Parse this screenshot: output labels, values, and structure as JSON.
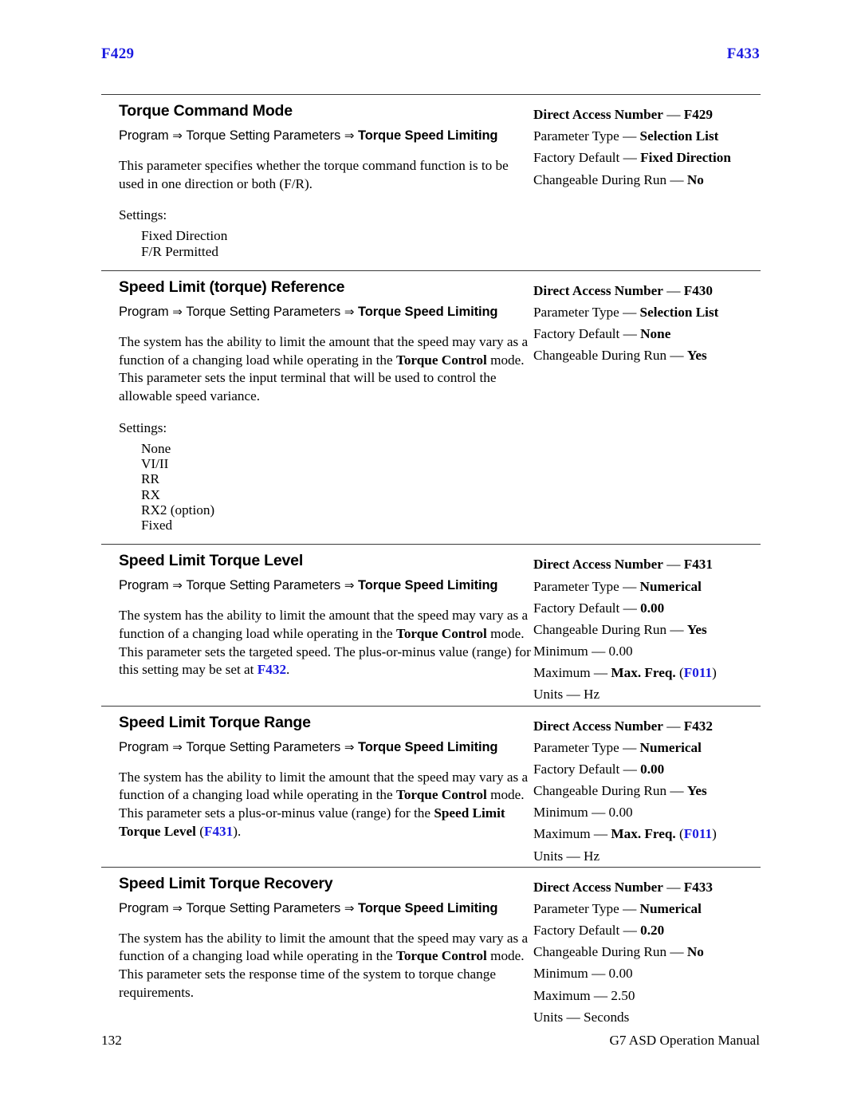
{
  "running_head": {
    "left": "F429",
    "right": "F433",
    "color": "#1a1ae0"
  },
  "footer": {
    "page_number": "132",
    "manual_title": "G7 ASD Operation Manual"
  },
  "common": {
    "breadcrumb_prefix": "Program",
    "breadcrumb_mid": "Torque Setting Parameters",
    "breadcrumb_end": "Torque Speed Limiting",
    "arrow": "⇒",
    "settings_label": "Settings:",
    "dash": "—",
    "key_direct_access": "Direct Access Number",
    "key_parameter_type": "Parameter Type",
    "key_factory_default": "Factory Default",
    "key_changeable": "Changeable During Run",
    "key_minimum": "Minimum",
    "key_maximum": "Maximum",
    "key_units": "Units"
  },
  "sections": [
    {
      "title": "Torque Command Mode",
      "description_parts": [
        {
          "text": "This parameter specifies whether the torque command function is to be used in one direction or both (F/R).",
          "style": "normal"
        }
      ],
      "settings": [
        "Fixed Direction",
        "F/R Permitted"
      ],
      "specs": {
        "direct_access_number": "F429",
        "parameter_type": "Selection List",
        "factory_default": "Fixed Direction",
        "changeable_during_run": "No"
      }
    },
    {
      "title": "Speed Limit (torque) Reference",
      "description_parts": [
        {
          "text": "The system has the ability to limit the amount that the speed may vary as a function of a changing load while operating in the ",
          "style": "normal"
        },
        {
          "text": "Torque Control",
          "style": "bold"
        },
        {
          "text": " mode. This parameter sets the input terminal that will be used to control the allowable speed variance.",
          "style": "normal"
        }
      ],
      "settings": [
        "None",
        "VI/II",
        "RR",
        "RX",
        "RX2 (option)",
        "Fixed"
      ],
      "specs": {
        "direct_access_number": "F430",
        "parameter_type": "Selection List",
        "factory_default": "None",
        "changeable_during_run": "Yes"
      }
    },
    {
      "title": "Speed Limit Torque Level",
      "description_parts": [
        {
          "text": "The system has the ability to limit the amount that the speed may vary as a function of a changing load while operating in the ",
          "style": "normal"
        },
        {
          "text": "Torque Control",
          "style": "bold"
        },
        {
          "text": " mode. This parameter sets the targeted speed. The plus-or-minus value (range) for this setting may be set at ",
          "style": "normal"
        },
        {
          "text": "F432",
          "style": "xref"
        },
        {
          "text": ".",
          "style": "normal"
        }
      ],
      "settings": [],
      "specs": {
        "direct_access_number": "F431",
        "parameter_type": "Numerical",
        "factory_default": "0.00",
        "changeable_during_run": "Yes",
        "minimum": "0.00",
        "maximum_label": "Max. Freq.",
        "maximum_xref": "F011",
        "units": "Hz"
      }
    },
    {
      "title": "Speed Limit Torque Range",
      "description_parts": [
        {
          "text": "The system has the ability to limit the amount that the speed may vary as a function of a changing load while operating in the ",
          "style": "normal"
        },
        {
          "text": "Torque Control",
          "style": "bold"
        },
        {
          "text": " mode. This parameter sets a plus-or-minus value (range) for the ",
          "style": "normal"
        },
        {
          "text": "Speed Limit Torque Level",
          "style": "bold"
        },
        {
          "text": " (",
          "style": "normal"
        },
        {
          "text": "F431",
          "style": "xref"
        },
        {
          "text": ").",
          "style": "normal"
        }
      ],
      "settings": [],
      "specs": {
        "direct_access_number": "F432",
        "parameter_type": "Numerical",
        "factory_default": "0.00",
        "changeable_during_run": "Yes",
        "minimum": "0.00",
        "maximum_label": "Max. Freq.",
        "maximum_xref": "F011",
        "units": "Hz"
      }
    },
    {
      "title": "Speed Limit Torque Recovery",
      "description_parts": [
        {
          "text": "The system has the ability to limit the amount that the speed may vary as a function of a changing load while operating in the ",
          "style": "normal"
        },
        {
          "text": "Torque Control",
          "style": "bold"
        },
        {
          "text": " mode. This parameter sets the response time of the system to torque change requirements.",
          "style": "normal"
        }
      ],
      "settings": [],
      "specs": {
        "direct_access_number": "F433",
        "parameter_type": "Numerical",
        "factory_default": "0.20",
        "changeable_during_run": "No",
        "minimum": "0.00",
        "maximum_plain": "2.50",
        "units": "Seconds"
      }
    }
  ]
}
